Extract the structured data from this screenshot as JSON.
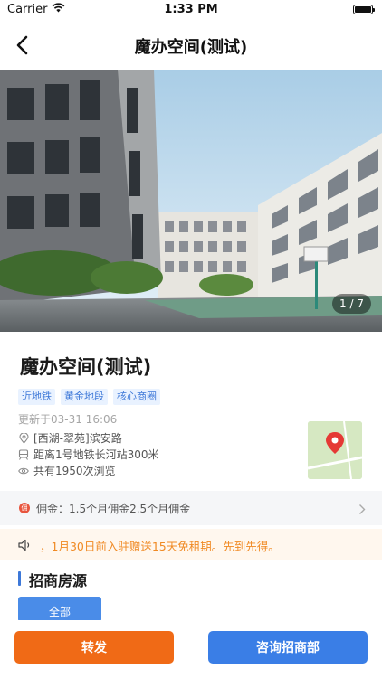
{
  "status_bar": {
    "carrier": "Carrier",
    "time": "1:33 PM"
  },
  "nav": {
    "title": "魔办空间(测试)"
  },
  "gallery": {
    "counter": "1 / 7"
  },
  "listing": {
    "title": "魔办空间(测试)",
    "tags": [
      "近地铁",
      "黄金地段",
      "核心商圈"
    ],
    "updated": "更新于03-31 16:06",
    "address": "[西湖-翠苑]滨安路",
    "metro": "距离1号地铁长河站300米",
    "views": "共有1950次浏览"
  },
  "commission": {
    "badge": "佣",
    "text": "佣金：1.5个月佣金2.5个月佣金"
  },
  "notice": {
    "text": "，1月30日前入驻赠送15天免租期。先到先得。"
  },
  "section": {
    "title": "招商房源",
    "filter_label": "全部"
  },
  "actions": {
    "forward_label": "转发",
    "consult_label": "咨询招商部"
  },
  "colors": {
    "accent_blue": "#3a7ee6",
    "accent_orange": "#f06a16",
    "notice_orange": "#f08a24",
    "tag_blue": "#3d78d8"
  }
}
